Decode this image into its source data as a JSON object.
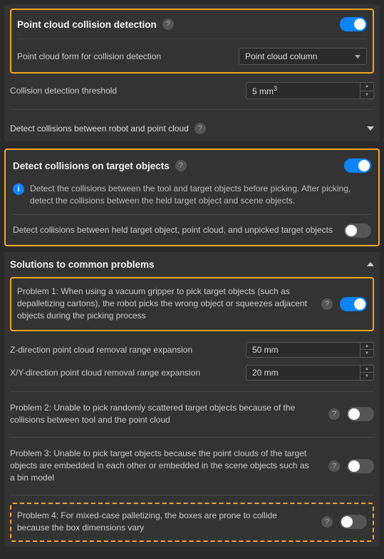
{
  "section1": {
    "title": "Point cloud collision detection",
    "toggle_on": true,
    "form_label": "Point cloud form for collision detection",
    "form_value": "Point cloud column",
    "threshold_label": "Collision detection threshold",
    "threshold_value": "5 mm³",
    "expand_label": "Detect collisions between robot and point cloud"
  },
  "section2": {
    "title": "Detect collisions on target objects",
    "toggle_on": true,
    "info": "Detect the collisions between the tool and target objects before picking. After picking, detect the collisions between the held target object and scene objects.",
    "setting1_label": "Detect collisions between held target object, point cloud, and unpicked target objects",
    "setting1_on": false
  },
  "section3": {
    "title": "Solutions to common problems",
    "expanded": true,
    "p1": {
      "text": "Problem 1: When using a vacuum gripper to pick target objects (such as depalletizing cartons), the robot picks the wrong object or squeezes adjacent objects during the picking process",
      "on": true,
      "z_label": "Z-direction point cloud removal range expansion",
      "z_value": "50 mm",
      "xy_label": "X/Y-direction point cloud removal range expansion",
      "xy_value": "20 mm"
    },
    "p2": {
      "text": "Problem 2: Unable to pick randomly scattered target objects because of the collisions between tool and the point cloud",
      "on": false
    },
    "p3": {
      "text": "Problem 3: Unable to pick target objects because the point clouds of the target objects are embedded in each other or embedded in the scene objects such as a bin model",
      "on": false
    },
    "p4": {
      "text": "Problem 4: For mixed-case palletizing, the boxes are prone to collide because the box dimensions vary",
      "on": false
    }
  }
}
